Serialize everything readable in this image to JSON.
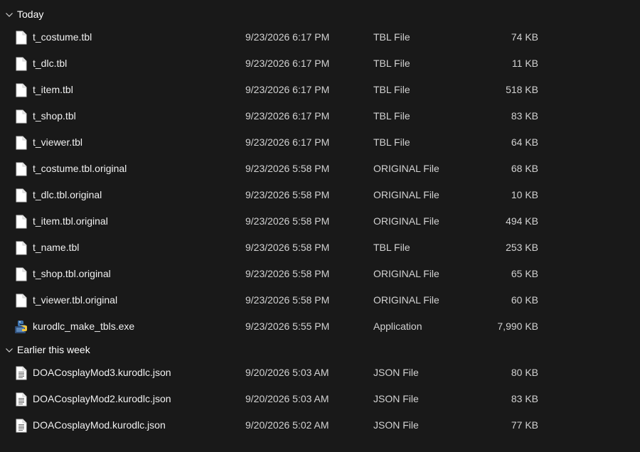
{
  "groups": [
    {
      "label": "Today",
      "files": [
        {
          "name": "t_costume.tbl",
          "date": "9/23/2026 6:17 PM",
          "type": "TBL File",
          "size": "74 KB",
          "icon": "document-icon"
        },
        {
          "name": "t_dlc.tbl",
          "date": "9/23/2026 6:17 PM",
          "type": "TBL File",
          "size": "11 KB",
          "icon": "document-icon"
        },
        {
          "name": "t_item.tbl",
          "date": "9/23/2026 6:17 PM",
          "type": "TBL File",
          "size": "518 KB",
          "icon": "document-icon"
        },
        {
          "name": "t_shop.tbl",
          "date": "9/23/2026 6:17 PM",
          "type": "TBL File",
          "size": "83 KB",
          "icon": "document-icon"
        },
        {
          "name": "t_viewer.tbl",
          "date": "9/23/2026 6:17 PM",
          "type": "TBL File",
          "size": "64 KB",
          "icon": "document-icon"
        },
        {
          "name": "t_costume.tbl.original",
          "date": "9/23/2026 5:58 PM",
          "type": "ORIGINAL File",
          "size": "68 KB",
          "icon": "document-icon"
        },
        {
          "name": "t_dlc.tbl.original",
          "date": "9/23/2026 5:58 PM",
          "type": "ORIGINAL File",
          "size": "10 KB",
          "icon": "document-icon"
        },
        {
          "name": "t_item.tbl.original",
          "date": "9/23/2026 5:58 PM",
          "type": "ORIGINAL File",
          "size": "494 KB",
          "icon": "document-icon"
        },
        {
          "name": "t_name.tbl",
          "date": "9/23/2026 5:58 PM",
          "type": "TBL File",
          "size": "253 KB",
          "icon": "document-icon"
        },
        {
          "name": "t_shop.tbl.original",
          "date": "9/23/2026 5:58 PM",
          "type": "ORIGINAL File",
          "size": "65 KB",
          "icon": "document-icon"
        },
        {
          "name": "t_viewer.tbl.original",
          "date": "9/23/2026 5:58 PM",
          "type": "ORIGINAL File",
          "size": "60 KB",
          "icon": "document-icon"
        },
        {
          "name": "kurodlc_make_tbls.exe",
          "date": "9/23/2026 5:55 PM",
          "type": "Application",
          "size": "7,990 KB",
          "icon": "python-exe-icon"
        }
      ]
    },
    {
      "label": "Earlier this week",
      "files": [
        {
          "name": "DOACosplayMod3.kurodlc.json",
          "date": "9/20/2026 5:03 AM",
          "type": "JSON File",
          "size": "80 KB",
          "icon": "text-document-icon"
        },
        {
          "name": "DOACosplayMod2.kurodlc.json",
          "date": "9/20/2026 5:03 AM",
          "type": "JSON File",
          "size": "83 KB",
          "icon": "text-document-icon"
        },
        {
          "name": "DOACosplayMod.kurodlc.json",
          "date": "9/20/2026 5:02 AM",
          "type": "JSON File",
          "size": "77 KB",
          "icon": "text-document-icon"
        }
      ]
    }
  ],
  "colors": {
    "background": "#191919",
    "text": "#f0f0f0",
    "secondary_text": "#d2d2d2"
  }
}
